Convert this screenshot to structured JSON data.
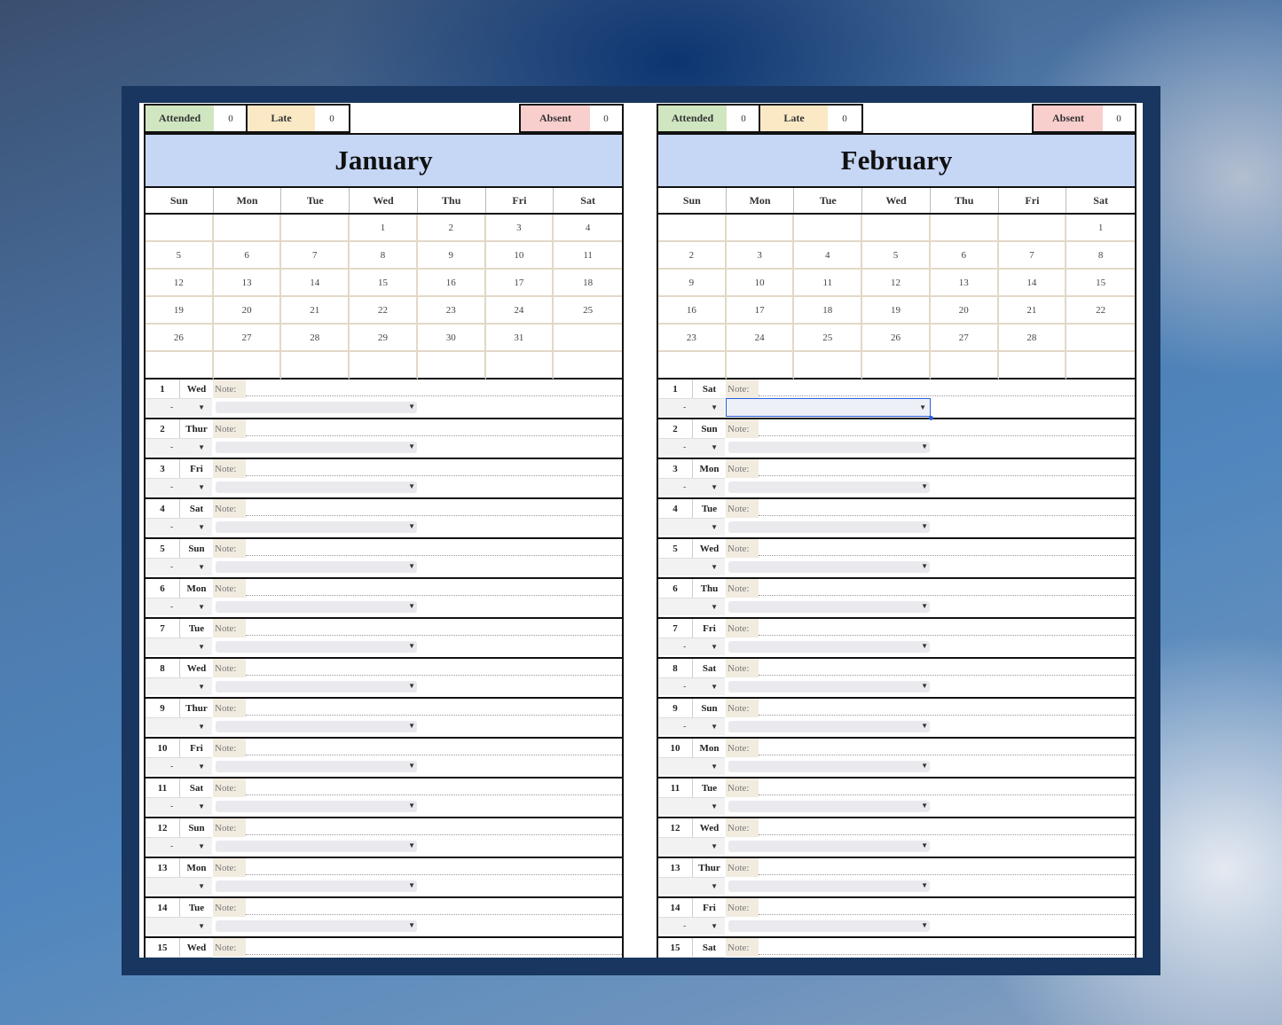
{
  "months": [
    {
      "name": "January",
      "stats": {
        "attended_label": "Attended",
        "attended_value": "0",
        "late_label": "Late",
        "late_value": "0",
        "absent_label": "Absent",
        "absent_value": "0"
      },
      "weekdays": [
        "Sun",
        "Mon",
        "Tue",
        "Wed",
        "Thu",
        "Fri",
        "Sat"
      ],
      "weeks": [
        [
          "",
          "",
          "",
          "1",
          "2",
          "3",
          "4"
        ],
        [
          "5",
          "6",
          "7",
          "8",
          "9",
          "10",
          "11"
        ],
        [
          "12",
          "13",
          "14",
          "15",
          "16",
          "17",
          "18"
        ],
        [
          "19",
          "20",
          "21",
          "22",
          "23",
          "24",
          "25"
        ],
        [
          "26",
          "27",
          "28",
          "29",
          "30",
          "31",
          ""
        ],
        [
          "",
          "",
          "",
          "",
          "",
          "",
          ""
        ]
      ],
      "days": [
        {
          "num": "1",
          "wd": "Wed",
          "note": "Note:",
          "status": "-"
        },
        {
          "num": "2",
          "wd": "Thur",
          "note": "Note:",
          "status": "-"
        },
        {
          "num": "3",
          "wd": "Fri",
          "note": "Note:",
          "status": "-"
        },
        {
          "num": "4",
          "wd": "Sat",
          "note": "Note:",
          "status": "-"
        },
        {
          "num": "5",
          "wd": "Sun",
          "note": "Note:",
          "status": "-"
        },
        {
          "num": "6",
          "wd": "Mon",
          "note": "Note:",
          "status": "-"
        },
        {
          "num": "7",
          "wd": "Tue",
          "note": "Note:",
          "status": ""
        },
        {
          "num": "8",
          "wd": "Wed",
          "note": "Note:",
          "status": ""
        },
        {
          "num": "9",
          "wd": "Thur",
          "note": "Note:",
          "status": ""
        },
        {
          "num": "10",
          "wd": "Fri",
          "note": "Note:",
          "status": "-"
        },
        {
          "num": "11",
          "wd": "Sat",
          "note": "Note:",
          "status": "-"
        },
        {
          "num": "12",
          "wd": "Sun",
          "note": "Note:",
          "status": "-"
        },
        {
          "num": "13",
          "wd": "Mon",
          "note": "Note:",
          "status": ""
        },
        {
          "num": "14",
          "wd": "Tue",
          "note": "Note:",
          "status": ""
        },
        {
          "num": "15",
          "wd": "Wed",
          "note": "Note:",
          "status": ""
        }
      ]
    },
    {
      "name": "February",
      "stats": {
        "attended_label": "Attended",
        "attended_value": "0",
        "late_label": "Late",
        "late_value": "0",
        "absent_label": "Absent",
        "absent_value": "0"
      },
      "weekdays": [
        "Sun",
        "Mon",
        "Tue",
        "Wed",
        "Thu",
        "Fri",
        "Sat"
      ],
      "weeks": [
        [
          "",
          "",
          "",
          "",
          "",
          "",
          "1"
        ],
        [
          "2",
          "3",
          "4",
          "5",
          "6",
          "7",
          "8"
        ],
        [
          "9",
          "10",
          "11",
          "12",
          "13",
          "14",
          "15"
        ],
        [
          "16",
          "17",
          "18",
          "19",
          "20",
          "21",
          "22"
        ],
        [
          "23",
          "24",
          "25",
          "26",
          "27",
          "28",
          ""
        ],
        [
          "",
          "",
          "",
          "",
          "",
          "",
          ""
        ]
      ],
      "days": [
        {
          "num": "1",
          "wd": "Sat",
          "note": "Note:",
          "status": "-"
        },
        {
          "num": "2",
          "wd": "Sun",
          "note": "Note:",
          "status": "-"
        },
        {
          "num": "3",
          "wd": "Mon",
          "note": "Note:",
          "status": "-"
        },
        {
          "num": "4",
          "wd": "Tue",
          "note": "Note:",
          "status": ""
        },
        {
          "num": "5",
          "wd": "Wed",
          "note": "Note:",
          "status": ""
        },
        {
          "num": "6",
          "wd": "Thu",
          "note": "Note:",
          "status": ""
        },
        {
          "num": "7",
          "wd": "Fri",
          "note": "Note:",
          "status": "-"
        },
        {
          "num": "8",
          "wd": "Sat",
          "note": "Note:",
          "status": "-"
        },
        {
          "num": "9",
          "wd": "Sun",
          "note": "Note:",
          "status": "-"
        },
        {
          "num": "10",
          "wd": "Mon",
          "note": "Note:",
          "status": ""
        },
        {
          "num": "11",
          "wd": "Tue",
          "note": "Note:",
          "status": ""
        },
        {
          "num": "12",
          "wd": "Wed",
          "note": "Note:",
          "status": ""
        },
        {
          "num": "13",
          "wd": "Thur",
          "note": "Note:",
          "status": ""
        },
        {
          "num": "14",
          "wd": "Fri",
          "note": "Note:",
          "status": "-"
        },
        {
          "num": "15",
          "wd": "Sat",
          "note": "Note:",
          "status": ""
        }
      ]
    }
  ],
  "colors": {
    "attended": "#cfe6c0",
    "late": "#fbe9c6",
    "absent": "#f9cfcd",
    "title_band": "#c6d7f6",
    "frame": "#18365f"
  },
  "icons": {
    "dropdown": "chevron-down-icon"
  }
}
